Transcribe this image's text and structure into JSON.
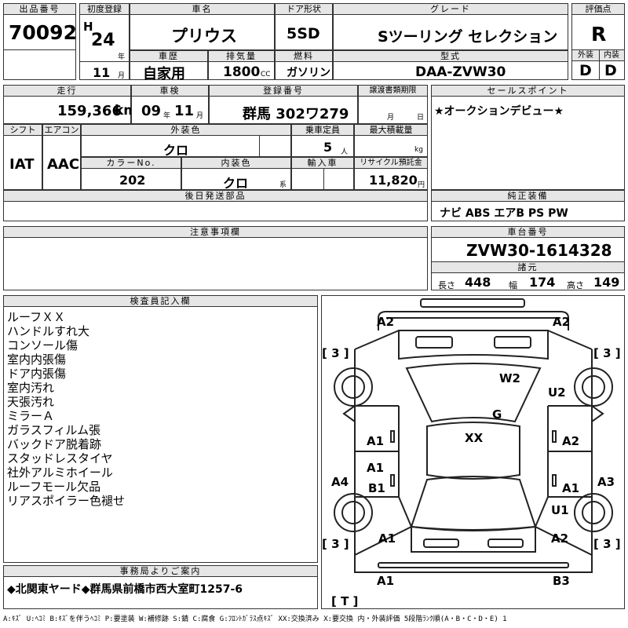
{
  "headers": {
    "lot_no": "出品番号",
    "first_reg": "初度登録",
    "car_name": "車名",
    "door": "ドア形状",
    "grade": "グレード",
    "score": "評価点",
    "history": "車歴",
    "displacement": "排気量",
    "fuel": "燃料",
    "model": "型式",
    "exterior": "外装",
    "interior": "内装",
    "mileage": "走行",
    "inspection": "車検",
    "plate": "登録番号",
    "transfer_deadline": "譲渡書類期限",
    "sales_point": "セールスポイント",
    "shift": "シフト",
    "aircon": "エアコン",
    "ext_color": "外装色",
    "capacity": "乗車定員",
    "max_load": "最大積載量",
    "color_no": "カラーNo.",
    "int_color": "内装色",
    "import": "輸入車",
    "recycle": "リサイクル預託金",
    "later_parts": "後日発送部品",
    "genuine": "純正装備",
    "notes": "注意事項欄",
    "chassis": "車台番号",
    "specs": "諸元",
    "inspector": "検査員記入欄",
    "office": "事務局よりご案内"
  },
  "vehicle": {
    "lot_no": "70092",
    "era": "H",
    "year": "24",
    "year_unit": "年",
    "month": "11",
    "month_unit": "月",
    "name": "プリウス",
    "door": "5SD",
    "grade": "Sツーリング セレクション",
    "score": "R",
    "history": "自家用",
    "displacement": "1800",
    "cc": "CC",
    "fuel": "ガソリン",
    "model": "DAA-ZVW30",
    "exterior_score": "D",
    "interior_score": "D",
    "mileage": "159,366",
    "km": "km",
    "insp_year": "09",
    "insp_month": "11",
    "year_u": "年",
    "month_u": "月",
    "plate": "群馬 302ワ279",
    "deadline_month": "月",
    "deadline_day": "日",
    "sales_point": "★オークションデビュー★",
    "shift": "IAT",
    "aircon": "AAC",
    "color": "クロ",
    "capacity": "5",
    "person": "人",
    "kg": "kg",
    "color_no": "202",
    "int_color": "クロ",
    "kei": "系",
    "recycle": "11,820",
    "yen": "円",
    "equipment": "ナビ ABS エアB PS PW",
    "chassis_no": "ZVW30-1614328",
    "len_label": "長さ",
    "length": "448",
    "wid_label": "幅",
    "width": "174",
    "hgt_label": "高さ",
    "height": "149"
  },
  "inspector_notes": [
    "ルーフＸＸ",
    "ハンドルすれ大",
    "コンソール傷",
    "室内内張傷",
    "ドア内張傷",
    "室内汚れ",
    "天張汚れ",
    "ミラーＡ",
    "ガラスフィルム張",
    "バックドア脱着跡",
    "スタッドレスタイヤ",
    "社外アルミホイール",
    "ルーフモール欠品",
    "リアスポイラー色褪せ"
  ],
  "office_notice": "◆北関東ヤード◆群馬県前橋市西大室町1257-6",
  "damage": {
    "front_left": "A2",
    "front_right": "A2",
    "tire_fl": "[ 3 ]",
    "tire_fr": "[ 3 ]",
    "hood": "W2",
    "fender_r": "U2",
    "windshield": "G",
    "roof": "XX",
    "door_fl": "A1",
    "door_fr": "A2",
    "door_rl": "A1",
    "rocker_l": "B1",
    "rocker_l_side": "A4",
    "door_rr": "A1",
    "rocker_r_side": "A3",
    "quarter_r": "U1",
    "rear_left": "A1",
    "rear_right": "A2",
    "tire_rl": "[ 3 ]",
    "tire_rr": "[ 3 ]",
    "bumper_l": "A1",
    "bumper_r": "B3",
    "spare": "[ T ]"
  },
  "legend": "A:ｷｽﾞ U:ﾍｺﾐ B:ｷｽﾞを伴うﾍｺﾐ P:要塗装 W:補修跡 S:錆 C:腐食 G:ﾌﾛﾝﾄｶﾞﾗｽ点ｷｽﾞ XX:交換済み X:要交換 内・外装評価 5段階ﾗﾝｸ順(A・B・C・D・E) 1"
}
